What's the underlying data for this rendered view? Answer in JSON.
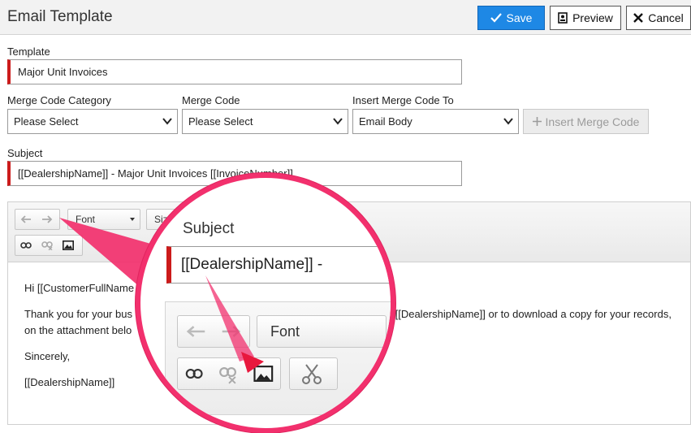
{
  "header": {
    "title": "Email Template",
    "save_label": "Save",
    "preview_label": "Preview",
    "cancel_label": "Cancel"
  },
  "form": {
    "template_label": "Template",
    "template_value": "Major Unit Invoices",
    "merge_code_category_label": "Merge Code Category",
    "merge_code_category_value": "Please Select",
    "merge_code_label": "Merge Code",
    "merge_code_value": "Please Select",
    "insert_to_label": "Insert Merge Code To",
    "insert_to_value": "Email Body",
    "insert_button_label": "Insert Merge Code",
    "subject_label": "Subject",
    "subject_value": "[[DealershipName]] - Major Unit Invoices [[InvoiceNumber]]"
  },
  "editor": {
    "toolbar": {
      "font_label": "Font",
      "size_label": "Size"
    },
    "body": {
      "greeting": "Hi [[CustomerFullName",
      "paragraph_1": "Thank you for your bus",
      "paragraph_1_tail": "from [[DealershipName]] or to download a copy for your records, click",
      "paragraph_1_line2": "on the attachment belo",
      "closing": "Sincerely,",
      "signature": "[[DealershipName]]"
    }
  },
  "magnifier": {
    "label": "Subject",
    "subject_value": "[[DealershipName]] -",
    "font_label": "Font"
  },
  "colors": {
    "save_button": "#1e88e5",
    "required_marker": "#cc1b1b",
    "callout_pink": "#f2306d"
  },
  "icons": [
    "save-icon",
    "preview-icon",
    "close-icon",
    "plus-icon",
    "undo-icon",
    "redo-icon",
    "link-icon",
    "unlink-icon",
    "image-icon",
    "cut-icon",
    "font-color-icon",
    "background-color-icon"
  ]
}
